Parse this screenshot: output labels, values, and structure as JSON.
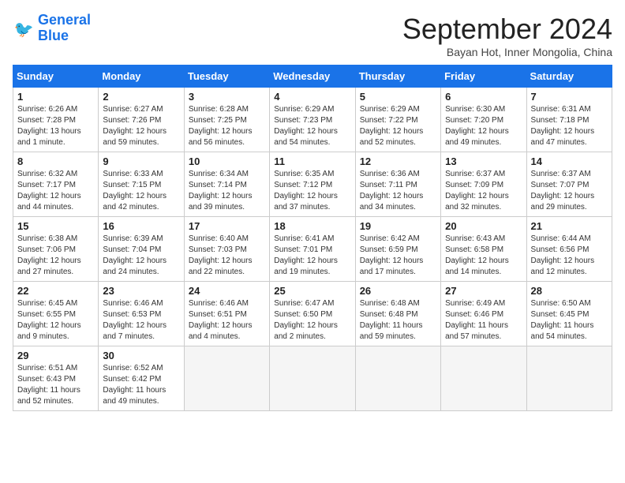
{
  "logo": {
    "line1": "General",
    "line2": "Blue"
  },
  "title": "September 2024",
  "subtitle": "Bayan Hot, Inner Mongolia, China",
  "weekdays": [
    "Sunday",
    "Monday",
    "Tuesday",
    "Wednesday",
    "Thursday",
    "Friday",
    "Saturday"
  ],
  "weeks": [
    [
      {
        "day": "1",
        "content": "Sunrise: 6:26 AM\nSunset: 7:28 PM\nDaylight: 13 hours\nand 1 minute."
      },
      {
        "day": "2",
        "content": "Sunrise: 6:27 AM\nSunset: 7:26 PM\nDaylight: 12 hours\nand 59 minutes."
      },
      {
        "day": "3",
        "content": "Sunrise: 6:28 AM\nSunset: 7:25 PM\nDaylight: 12 hours\nand 56 minutes."
      },
      {
        "day": "4",
        "content": "Sunrise: 6:29 AM\nSunset: 7:23 PM\nDaylight: 12 hours\nand 54 minutes."
      },
      {
        "day": "5",
        "content": "Sunrise: 6:29 AM\nSunset: 7:22 PM\nDaylight: 12 hours\nand 52 minutes."
      },
      {
        "day": "6",
        "content": "Sunrise: 6:30 AM\nSunset: 7:20 PM\nDaylight: 12 hours\nand 49 minutes."
      },
      {
        "day": "7",
        "content": "Sunrise: 6:31 AM\nSunset: 7:18 PM\nDaylight: 12 hours\nand 47 minutes."
      }
    ],
    [
      {
        "day": "8",
        "content": "Sunrise: 6:32 AM\nSunset: 7:17 PM\nDaylight: 12 hours\nand 44 minutes."
      },
      {
        "day": "9",
        "content": "Sunrise: 6:33 AM\nSunset: 7:15 PM\nDaylight: 12 hours\nand 42 minutes."
      },
      {
        "day": "10",
        "content": "Sunrise: 6:34 AM\nSunset: 7:14 PM\nDaylight: 12 hours\nand 39 minutes."
      },
      {
        "day": "11",
        "content": "Sunrise: 6:35 AM\nSunset: 7:12 PM\nDaylight: 12 hours\nand 37 minutes."
      },
      {
        "day": "12",
        "content": "Sunrise: 6:36 AM\nSunset: 7:11 PM\nDaylight: 12 hours\nand 34 minutes."
      },
      {
        "day": "13",
        "content": "Sunrise: 6:37 AM\nSunset: 7:09 PM\nDaylight: 12 hours\nand 32 minutes."
      },
      {
        "day": "14",
        "content": "Sunrise: 6:37 AM\nSunset: 7:07 PM\nDaylight: 12 hours\nand 29 minutes."
      }
    ],
    [
      {
        "day": "15",
        "content": "Sunrise: 6:38 AM\nSunset: 7:06 PM\nDaylight: 12 hours\nand 27 minutes."
      },
      {
        "day": "16",
        "content": "Sunrise: 6:39 AM\nSunset: 7:04 PM\nDaylight: 12 hours\nand 24 minutes."
      },
      {
        "day": "17",
        "content": "Sunrise: 6:40 AM\nSunset: 7:03 PM\nDaylight: 12 hours\nand 22 minutes."
      },
      {
        "day": "18",
        "content": "Sunrise: 6:41 AM\nSunset: 7:01 PM\nDaylight: 12 hours\nand 19 minutes."
      },
      {
        "day": "19",
        "content": "Sunrise: 6:42 AM\nSunset: 6:59 PM\nDaylight: 12 hours\nand 17 minutes."
      },
      {
        "day": "20",
        "content": "Sunrise: 6:43 AM\nSunset: 6:58 PM\nDaylight: 12 hours\nand 14 minutes."
      },
      {
        "day": "21",
        "content": "Sunrise: 6:44 AM\nSunset: 6:56 PM\nDaylight: 12 hours\nand 12 minutes."
      }
    ],
    [
      {
        "day": "22",
        "content": "Sunrise: 6:45 AM\nSunset: 6:55 PM\nDaylight: 12 hours\nand 9 minutes."
      },
      {
        "day": "23",
        "content": "Sunrise: 6:46 AM\nSunset: 6:53 PM\nDaylight: 12 hours\nand 7 minutes."
      },
      {
        "day": "24",
        "content": "Sunrise: 6:46 AM\nSunset: 6:51 PM\nDaylight: 12 hours\nand 4 minutes."
      },
      {
        "day": "25",
        "content": "Sunrise: 6:47 AM\nSunset: 6:50 PM\nDaylight: 12 hours\nand 2 minutes."
      },
      {
        "day": "26",
        "content": "Sunrise: 6:48 AM\nSunset: 6:48 PM\nDaylight: 11 hours\nand 59 minutes."
      },
      {
        "day": "27",
        "content": "Sunrise: 6:49 AM\nSunset: 6:46 PM\nDaylight: 11 hours\nand 57 minutes."
      },
      {
        "day": "28",
        "content": "Sunrise: 6:50 AM\nSunset: 6:45 PM\nDaylight: 11 hours\nand 54 minutes."
      }
    ],
    [
      {
        "day": "29",
        "content": "Sunrise: 6:51 AM\nSunset: 6:43 PM\nDaylight: 11 hours\nand 52 minutes."
      },
      {
        "day": "30",
        "content": "Sunrise: 6:52 AM\nSunset: 6:42 PM\nDaylight: 11 hours\nand 49 minutes."
      },
      {
        "day": "",
        "content": ""
      },
      {
        "day": "",
        "content": ""
      },
      {
        "day": "",
        "content": ""
      },
      {
        "day": "",
        "content": ""
      },
      {
        "day": "",
        "content": ""
      }
    ]
  ]
}
